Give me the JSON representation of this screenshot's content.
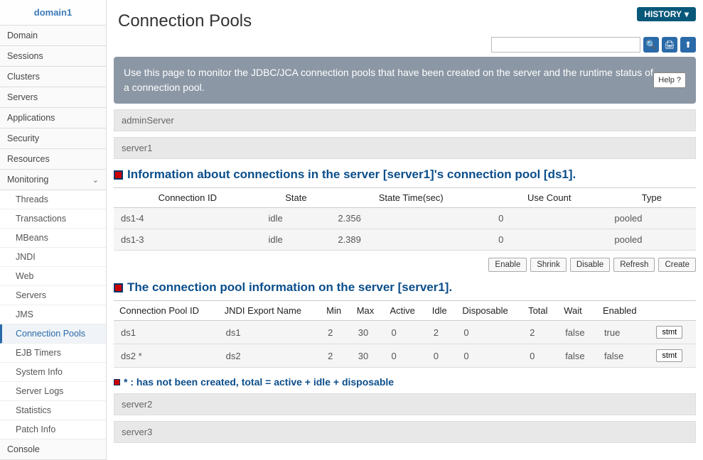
{
  "sidebar": {
    "title": "domain1",
    "items": [
      "Domain",
      "Sessions",
      "Clusters",
      "Servers",
      "Applications",
      "Security",
      "Resources"
    ],
    "monitoring_label": "Monitoring",
    "sub": [
      "Threads",
      "Transactions",
      "MBeans",
      "JNDI",
      "Web",
      "Servers",
      "JMS",
      "Connection Pools",
      "EJB Timers",
      "System Info",
      "Server Logs",
      "Statistics",
      "Patch Info"
    ],
    "active_sub": "Connection Pools",
    "console": "Console"
  },
  "header": {
    "title": "Connection Pools",
    "history": "HISTORY",
    "search_placeholder": ""
  },
  "banner": {
    "text": "Use this page to monitor the JDBC/JCA connection pools that have been created on the server and the runtime status of a connection pool.",
    "help": "Help"
  },
  "servers": {
    "admin": "adminServer",
    "s1": "server1",
    "s2": "server2",
    "s3": "server3"
  },
  "connTitle": "Information about connections in the server [server1]'s connection pool [ds1].",
  "connCols": [
    "Connection ID",
    "State",
    "State Time(sec)",
    "Use Count",
    "Type"
  ],
  "connRows": [
    {
      "id": "ds1-4",
      "state": "idle",
      "time": "2.356",
      "use": "0",
      "type": "pooled"
    },
    {
      "id": "ds1-3",
      "state": "idle",
      "time": "2.389",
      "use": "0",
      "type": "pooled"
    }
  ],
  "actions": [
    "Enable",
    "Shrink",
    "Disable",
    "Refresh",
    "Create"
  ],
  "poolTitle": "The connection pool information on the server [server1].",
  "poolCols": [
    "Connection Pool ID",
    "JNDI Export Name",
    "Min",
    "Max",
    "Active",
    "Idle",
    "Disposable",
    "Total",
    "Wait",
    "Enabled",
    ""
  ],
  "poolRows": [
    {
      "id": "ds1",
      "jndi": "ds1",
      "min": "2",
      "max": "30",
      "active": "0",
      "idle": "2",
      "disp": "0",
      "total": "2",
      "wait": "false",
      "enabled": "true",
      "btn": "stmt"
    },
    {
      "id": "ds2 *",
      "jndi": "ds2",
      "min": "2",
      "max": "30",
      "active": "0",
      "idle": "0",
      "disp": "0",
      "total": "0",
      "wait": "false",
      "enabled": "false",
      "btn": "stmt"
    }
  ],
  "note": "* : has not been created, total = active + idle + disposable"
}
